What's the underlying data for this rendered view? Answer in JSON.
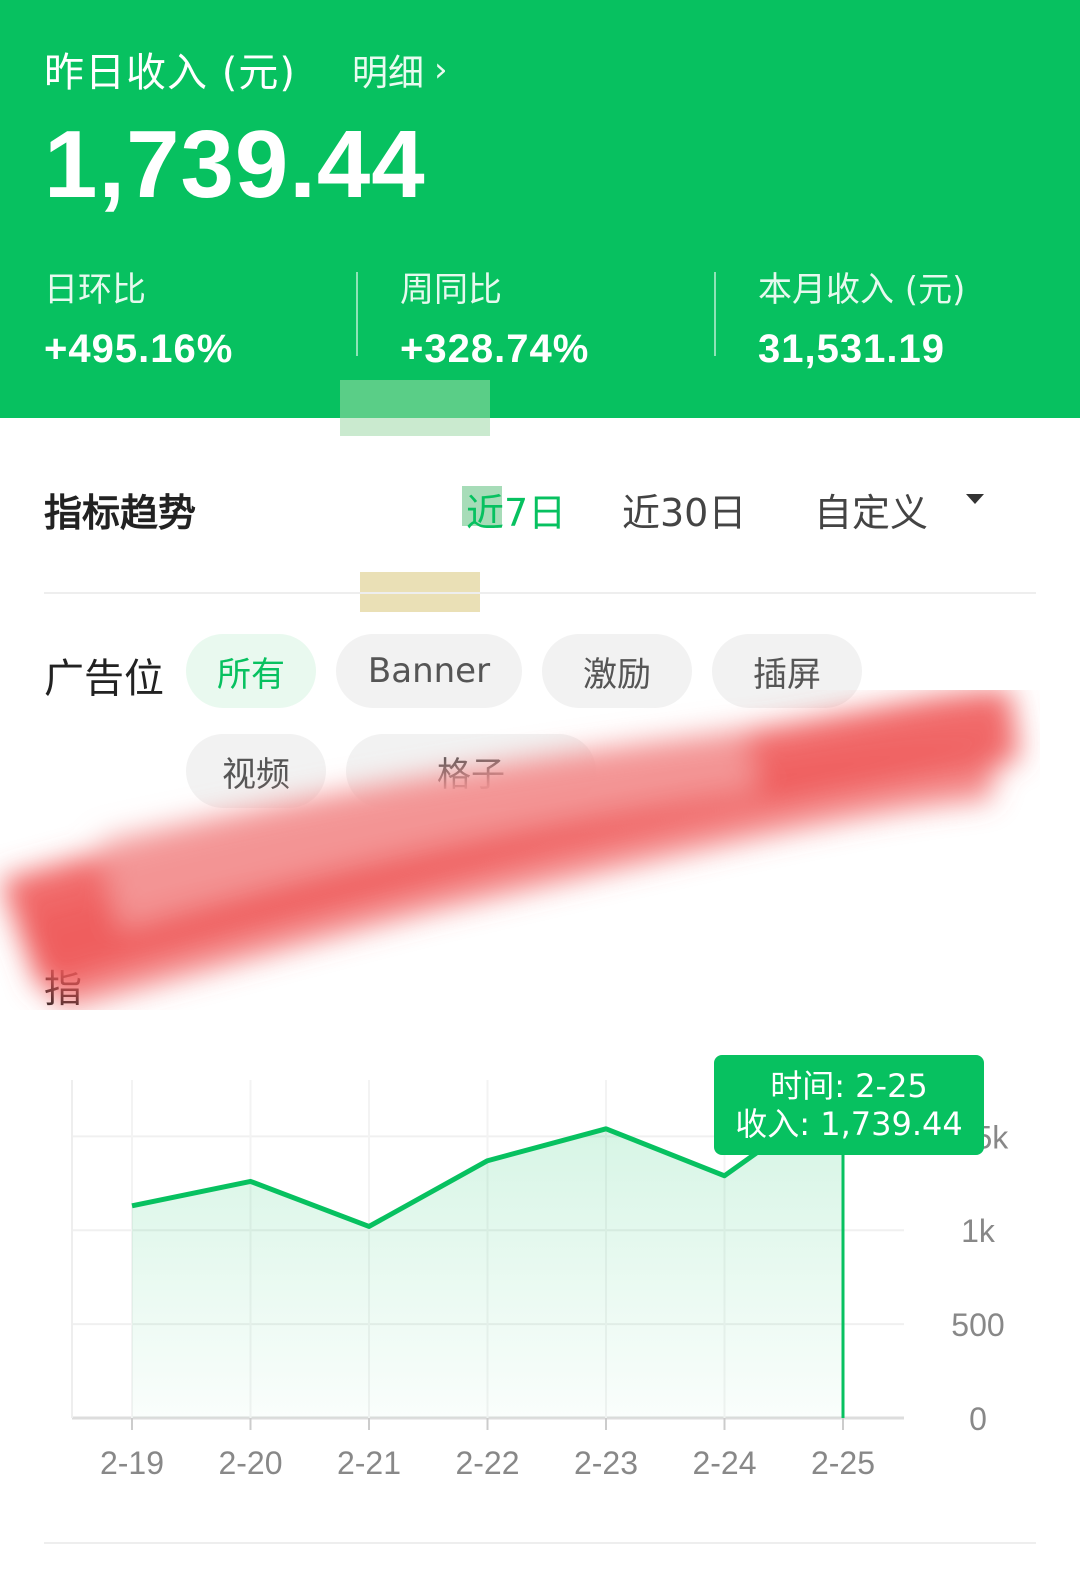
{
  "header": {
    "title": "昨日收入 (元)",
    "detail_link": "明细",
    "amount": "1,739.44",
    "stats": [
      {
        "label": "日环比",
        "value": "+495.16%"
      },
      {
        "label": "周同比",
        "value": "+328.74%"
      },
      {
        "label": "本月收入 (元)",
        "value": "31,531.19"
      }
    ]
  },
  "trend": {
    "title": "指标趋势",
    "ranges": [
      {
        "label": "近7日",
        "active": true
      },
      {
        "label": "近30日",
        "active": false
      },
      {
        "label": "自定义",
        "active": false
      }
    ]
  },
  "ad_slots": {
    "label": "广告位",
    "chips": [
      {
        "label": "所有",
        "active": true
      },
      {
        "label": "Banner",
        "active": false
      },
      {
        "label": "激励",
        "active": false
      },
      {
        "label": "插屏",
        "active": false
      },
      {
        "label": "视频",
        "active": false
      },
      {
        "label": "格子",
        "active": false
      }
    ]
  },
  "metric_label": "指",
  "colors": {
    "accent": "#07c160",
    "smear": "#f05a5a"
  },
  "chart_data": {
    "type": "area",
    "x": [
      "2-19",
      "2-20",
      "2-21",
      "2-22",
      "2-23",
      "2-24",
      "2-25"
    ],
    "series": [
      {
        "values": [
          1130,
          1260,
          1020,
          1370,
          1540,
          1290,
          1739.44
        ]
      }
    ],
    "y_ticks": [
      "0",
      "500",
      "1k",
      "1.5k"
    ],
    "ylim": [
      0,
      1800
    ],
    "grid": true,
    "tooltip": {
      "time_label": "时间: 2-25",
      "value_label": "收入: 1,739.44",
      "index": 6
    }
  }
}
